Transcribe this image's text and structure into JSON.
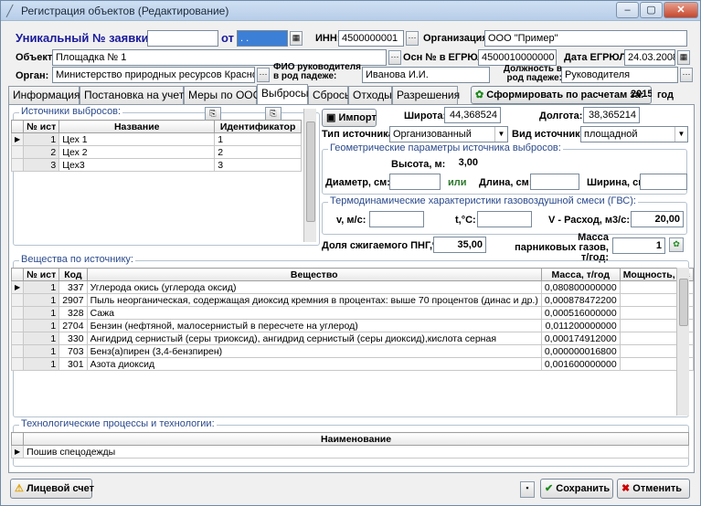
{
  "window": {
    "title": "Регистрация объектов (Редактирование)",
    "min": "–",
    "max": "▢",
    "close": "✕"
  },
  "header": {
    "request_label": "Уникальный № заявки:",
    "request_value": "",
    "from_label": "от",
    "date_value": ". .",
    "inn_label": "ИНН:",
    "inn_value": "4500000001",
    "org_label": "Организация:",
    "org_value": "ООО \"Пример\"",
    "object_label": "Объект:",
    "object_value": "Площадка № 1",
    "ogrn_label": "Осн № в ЕГРЮЛ:",
    "ogrn_value": "4500010000000",
    "egrul_date_label": "Дата ЕГРЮЛ:",
    "egrul_date_value": "24.03.2008",
    "organ_label": "Орган:",
    "organ_value": "Министерство природных ресурсов Краснода",
    "fio_label": "ФИО руководителя в род падеже:",
    "fio_value": "Иванова И.И.",
    "position_label": "Должность в род падеже:",
    "position_value": "Руководителя"
  },
  "tabs": [
    "Информация",
    "Постановка на учет",
    "Меры по ООС",
    "Выбросы",
    "Сбросы",
    "Отходы",
    "Разрешения"
  ],
  "calc": {
    "button": "Сформировать по расчетам за:",
    "year": "2015",
    "year_suffix": "год"
  },
  "sources": {
    "group_title": "Источники выбросов:",
    "columns": [
      "№ ист",
      "Название",
      "Идентификатор"
    ],
    "rows": [
      {
        "n": "1",
        "name": "Цех 1",
        "id": "1"
      },
      {
        "n": "2",
        "name": "Цех 2",
        "id": "2"
      },
      {
        "n": "3",
        "name": "Цех3",
        "id": "3"
      }
    ]
  },
  "source_props": {
    "import_label": "Импорт",
    "lat_label": "Широта:",
    "lat_value": "44,368524",
    "lon_label": "Долгота:",
    "lon_value": "38,365214",
    "type_label": "Тип источника:",
    "type_value": "Организованный",
    "kind_label": "Вид источника:",
    "kind_value": "площадной",
    "geom_title": "Геометрические параметры источника выбросов:",
    "height_label": "Высота, м:",
    "height_value": "3,00",
    "diam_label": "Диаметр, см:",
    "or_label": "или",
    "len_label": "Длина, см:",
    "width_label": "Ширина, см:",
    "thermo_title": "Термодинамические характеристики газовоздушной смеси (ГВС):",
    "v_label": "v, м/с:",
    "t_label": "t,°C:",
    "vol_label": "V - Расход, м3/с:",
    "vol_value": "20,00",
    "png_label": "Доля сжигаемого ПНГ,%:",
    "png_value": "35,00",
    "ghg_label": "Масса парниковых газов, т/год:",
    "ghg_value": "1"
  },
  "substances": {
    "group_title": "Вещества по источнику:",
    "columns": [
      "№ ист",
      "Код",
      "Вещество",
      "Масса, т/год",
      "Мощность, г/с"
    ],
    "rows": [
      {
        "n": "1",
        "code": "337",
        "name": "Углерода окись (углерода оксид)",
        "mass": "0,080800000000",
        "power": ""
      },
      {
        "n": "1",
        "code": "2907",
        "name": "Пыль неорганическая, содержащая диоксид кремния в процентах: выше 70 процентов (динас и др.)",
        "mass": "0,000878472200",
        "power": ""
      },
      {
        "n": "1",
        "code": "328",
        "name": "Сажа",
        "mass": "0,000516000000",
        "power": ""
      },
      {
        "n": "1",
        "code": "2704",
        "name": "Бензин (нефтяной, малосернистый в пересчете на углерод)",
        "mass": "0,011200000000",
        "power": ""
      },
      {
        "n": "1",
        "code": "330",
        "name": "Ангидрид сернистый (серы триоксид), ангидрид сернистый (серы диоксид),кислота серная",
        "mass": "0,000174912000",
        "power": ""
      },
      {
        "n": "1",
        "code": "703",
        "name": "Бенз(а)пирен (3,4-бензпирен)",
        "mass": "0,000000016800",
        "power": ""
      },
      {
        "n": "1",
        "code": "301",
        "name": "Азота диоксид",
        "mass": "0,001600000000",
        "power": ""
      }
    ]
  },
  "tech": {
    "group_title": "Технологические процессы и технологии:",
    "column": "Наименование",
    "rows": [
      "Пошив спецодежды"
    ]
  },
  "footer": {
    "account": "Лицевой счет",
    "save": "Сохранить",
    "cancel": "Отменить"
  }
}
